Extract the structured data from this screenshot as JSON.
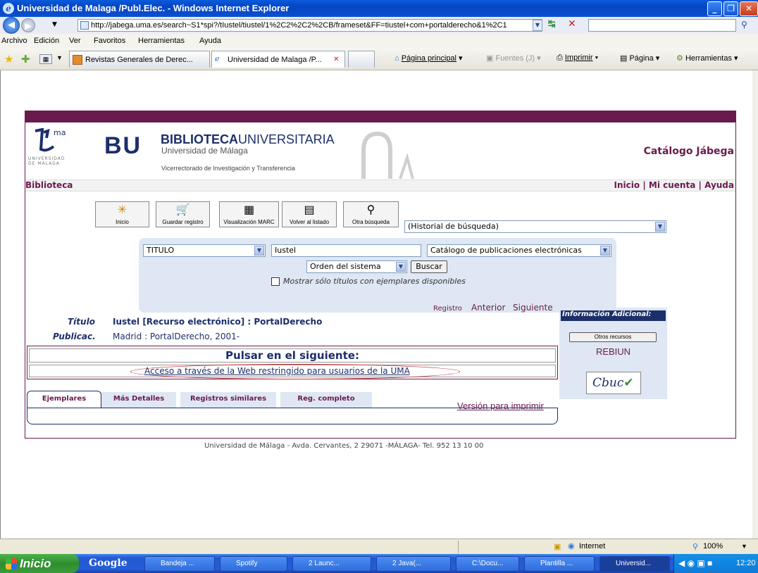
{
  "window": {
    "title": "Universidad de Malaga /Publ.Elec. - Windows Internet Explorer"
  },
  "address": {
    "url": "http://jabega.uma.es/search~S1*spi?/tIustel/tiustel/1%2C2%2C2%2CB/frameset&FF=tiustel+com+portalderecho&1%2C1"
  },
  "menu": {
    "items": [
      "Archivo",
      "Edición",
      "Ver",
      "Favoritos",
      "Herramientas",
      "Ayuda"
    ]
  },
  "tabs": [
    {
      "label": "Revistas Generales de Derec..."
    },
    {
      "label": "Universidad de Malaga /P...",
      "close": "✕"
    }
  ],
  "commands": {
    "home": "Página principal",
    "feeds": "Fuentes (J)",
    "print": "Imprimir",
    "page": "Página",
    "tools": "Herramientas"
  },
  "header": {
    "uma_logo": "ma",
    "uma_text": "UNIVERSIDAD\nDE MÁLAGA",
    "bu": "BU",
    "biblio_bold": "BIBLIOTECA",
    "biblio_rest": "UNIVERSITARIA",
    "univ": "Universidad de Málaga",
    "vice": "Vicerrectorado de Investigación y Transferencia",
    "catalog": "Catálogo Jábega"
  },
  "libbar": {
    "left": "Biblioteca",
    "links": [
      "Inicio",
      "Mi cuenta",
      "Ayuda"
    ],
    "sep": "|"
  },
  "toolbar": {
    "buttons": [
      {
        "label": "Inicio",
        "icon": "✳"
      },
      {
        "label": "Guardar registro",
        "icon": "🛒"
      },
      {
        "label": "Visualización MARC",
        "icon": "▦"
      },
      {
        "label": "Volver al listado",
        "icon": "▤"
      },
      {
        "label": "Otra búsqueda",
        "icon": "⚲"
      }
    ],
    "history": "(Historial de búsqueda)"
  },
  "search": {
    "field": "TITULO",
    "term": "Iustel",
    "catalog": "Catálogo de publicaciones electrónicas",
    "order": "Orden del sistema",
    "button": "Buscar",
    "checkbox_label": "Mostrar sólo títulos con ejemplares disponibles"
  },
  "record": {
    "nav_label": "Registro",
    "prev": "Anterior",
    "next": "Siguiente",
    "title_label": "Título",
    "title_value": "Iustel [Recurso electrónico] : PortalDerecho",
    "pub_label": "Publicac.",
    "pub_value": "Madrid : PortalDerecho, 2001-",
    "click_heading": "Pulsar en el siguiente:",
    "access_link": "Acceso a través de la Web restringido para usuarios de la UMA"
  },
  "info": {
    "heading": "Información Adicional:",
    "other": "Otros recursos",
    "rebiun": "REBIUN",
    "cbuc": "Cbuc"
  },
  "record_tabs": {
    "items": [
      "Ejemplares",
      "Más Detalles",
      "Registros similares",
      "Reg. completo"
    ],
    "print": "Versión para imprimir"
  },
  "footer": "Universidad de Málaga - Avda. Cervantes, 2 29071 -MÁLAGA- Tel. 952 13 10 00",
  "status": {
    "zone": "Internet",
    "zoom": "100%"
  },
  "taskbar": {
    "start": "Inicio",
    "google": "Google",
    "items": [
      "Bandeja ...",
      "Spotify",
      "2 Launc...",
      "2 Java(...",
      "C:\\Docu...",
      "Plantilla ...",
      "Universid..."
    ],
    "clock": "12:20"
  }
}
